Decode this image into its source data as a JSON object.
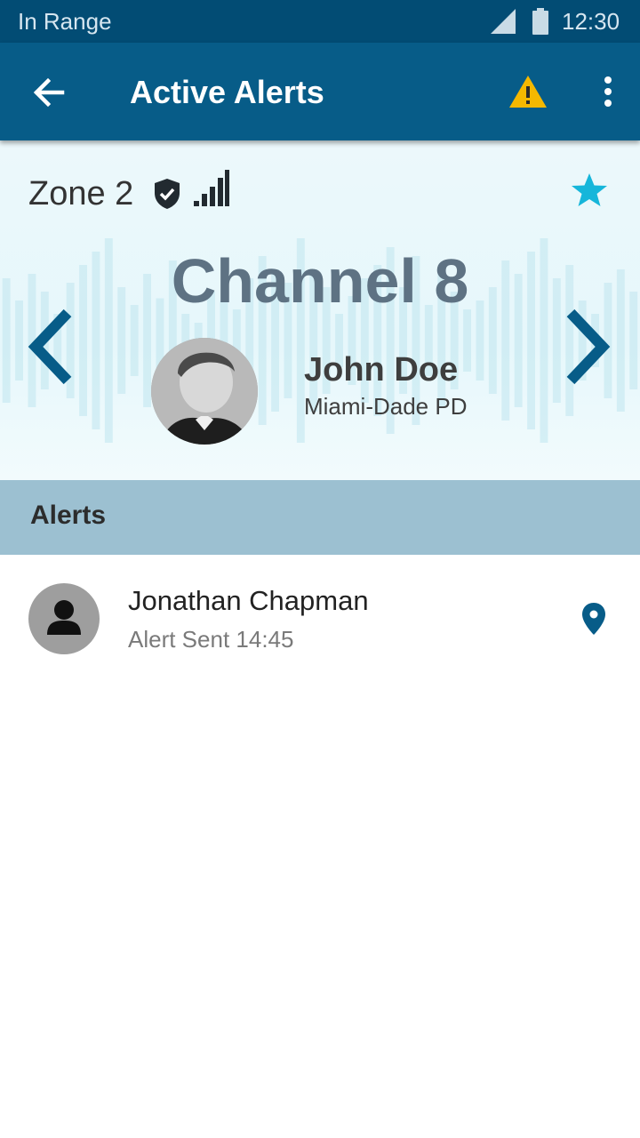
{
  "status_bar": {
    "carrier": "In Range",
    "time": "12:30",
    "icons": [
      "cell-signal-icon",
      "battery-icon"
    ]
  },
  "app_bar": {
    "title": "Active Alerts",
    "icons": [
      "back-arrow-icon",
      "warning-icon",
      "more-vert-icon"
    ],
    "warning_color": "#f5b800"
  },
  "channel": {
    "zone": "Zone 2",
    "name": "Channel 8",
    "icons": [
      "verified-shield-icon",
      "signal-bars-icon",
      "star-icon",
      "chevron-left-icon",
      "chevron-right-icon"
    ],
    "favorite_color": "#16b6da",
    "chevron_color": "#075c88"
  },
  "speaker": {
    "name": "John Doe",
    "organization": "Miami-Dade PD"
  },
  "alerts": {
    "header": "Alerts",
    "items": [
      {
        "name": "Jonathan Chapman",
        "status": "Alert Sent 14:45"
      }
    ]
  },
  "colors": {
    "status_bar": "#024c74",
    "app_bar": "#075c88",
    "section_header": "#9cc0d1"
  }
}
